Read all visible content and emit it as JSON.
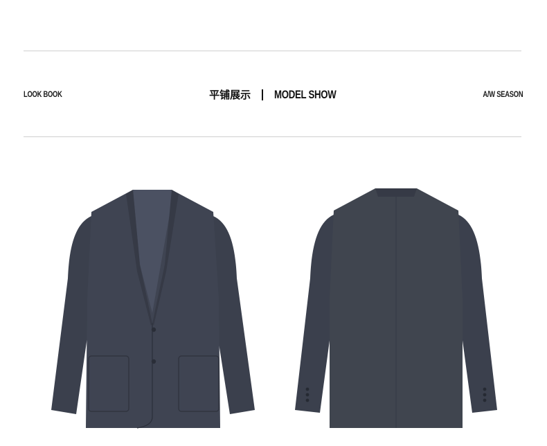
{
  "header": {
    "left_label": "LOOK BOOK",
    "title_cn": "平铺展示",
    "title_en": "MODEL SHOW",
    "right_label": "A/W SEASON"
  },
  "images": {
    "front": "blazer-front-view",
    "back": "blazer-back-view"
  },
  "colors": {
    "garment": "#3f4452",
    "garment_shadow": "#2f333f",
    "lining": "#4a5060",
    "rule": "#cfcfcf"
  }
}
